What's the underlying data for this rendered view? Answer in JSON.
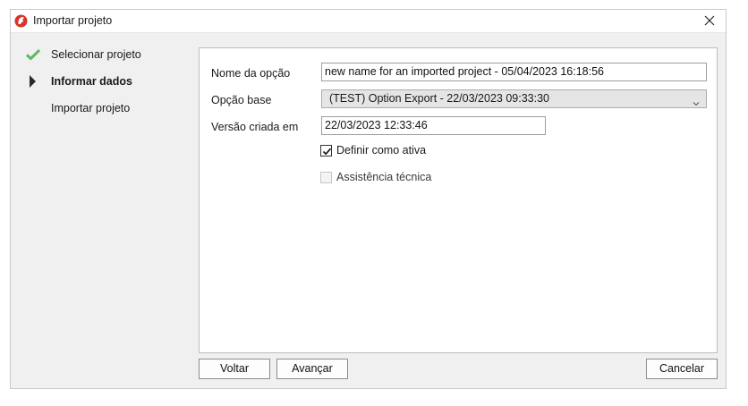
{
  "window": {
    "title": "Importar projeto",
    "app_icon": "rhino-logo-icon",
    "close_icon": "close-icon"
  },
  "steps": [
    {
      "label": "Selecionar projeto",
      "state": "done",
      "icon": "checkmark-icon"
    },
    {
      "label": "Informar dados",
      "state": "active",
      "icon": "triangle-right-icon"
    },
    {
      "label": "Importar projeto",
      "state": "pending",
      "icon": ""
    }
  ],
  "form": {
    "option_name_label": "Nome da opção",
    "option_name_value": "new name for an imported project - 05/04/2023 16:18:56",
    "base_option_label": "Opção base",
    "base_option_value": "(TEST) Option Export - 22/03/2023 09:33:30",
    "created_label": "Versão criada em",
    "created_value": "22/03/2023 12:33:46",
    "set_active_label": "Definir como ativa",
    "set_active_checked": true,
    "tech_support_label": "Assistência técnica",
    "tech_support_checked": false
  },
  "buttons": {
    "back": "Voltar",
    "next": "Avançar",
    "cancel": "Cancelar"
  },
  "colors": {
    "check_green": "#5cb85c",
    "app_icon_red": "#d9342b"
  }
}
